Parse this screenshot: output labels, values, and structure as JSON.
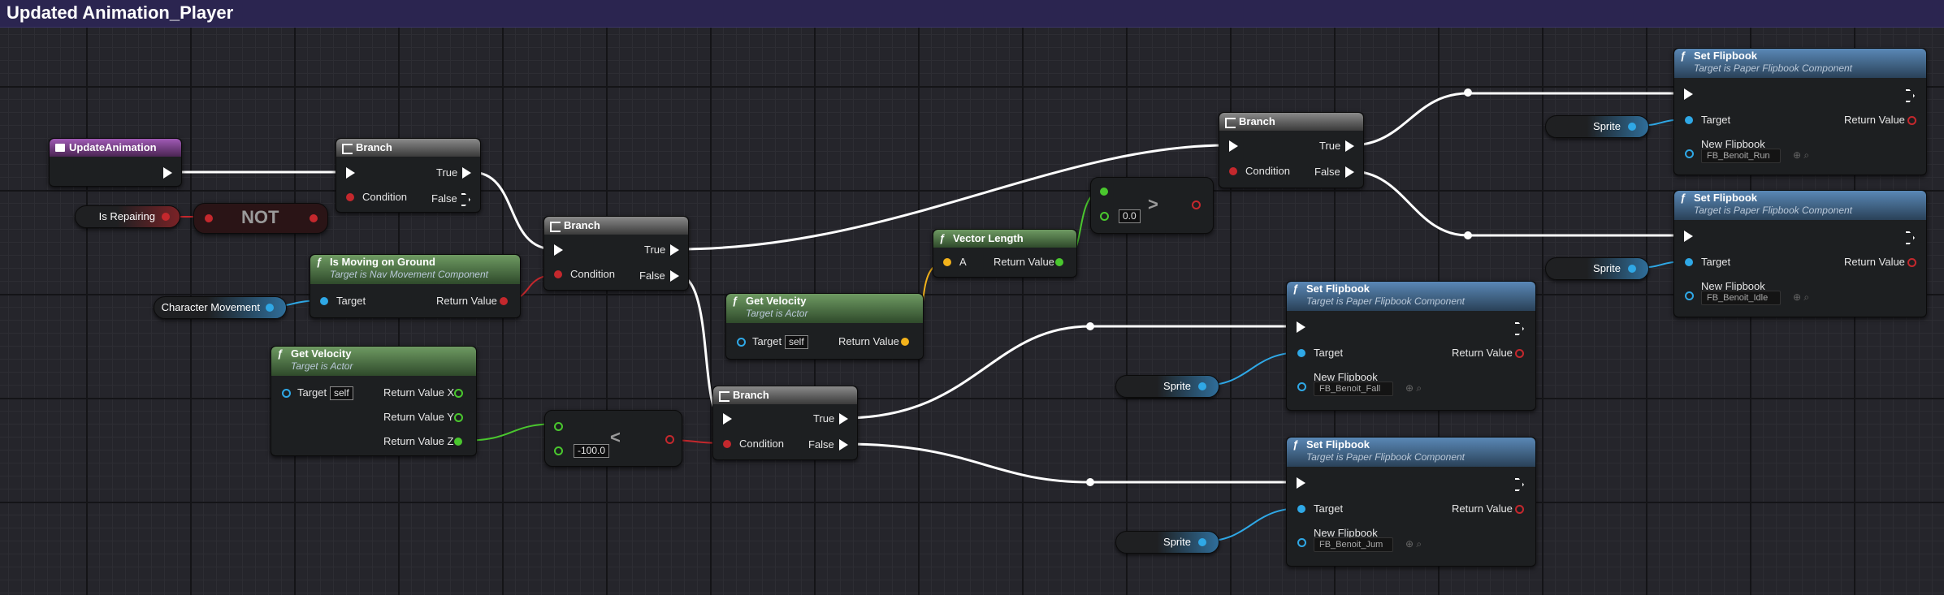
{
  "window": {
    "title": "Updated Animation_Player"
  },
  "colors": {
    "exec": "#ffffff",
    "object": "#2fa8e6",
    "boolean": "#c4282d",
    "float": "#4ac72e",
    "vector": "#f2b21b"
  },
  "nodes": {
    "update_animation": {
      "title": "UpdateAnimation"
    },
    "is_repairing": {
      "label": "Is Repairing"
    },
    "not_node": {
      "label": "NOT"
    },
    "branch1": {
      "title": "Branch",
      "true_label": "True",
      "false_label": "False",
      "condition_label": "Condition"
    },
    "is_moving_on_ground": {
      "title": "Is Moving on Ground",
      "subtitle": "Target is Nav Movement Component",
      "target_label": "Target",
      "return_label": "Return Value"
    },
    "character_movement": {
      "label": "Character Movement"
    },
    "get_velocity_1": {
      "title": "Get Velocity",
      "subtitle": "Target is Actor",
      "target_label": "Target",
      "target_value": "self",
      "x_label": "Return Value X",
      "y_label": "Return Value Y",
      "z_label": "Return Value Z"
    },
    "branch2": {
      "title": "Branch",
      "true_label": "True",
      "false_label": "False",
      "condition_label": "Condition"
    },
    "less_than": {
      "operator": "<",
      "value": "-100.0"
    },
    "get_velocity_2": {
      "title": "Get Velocity",
      "subtitle": "Target is Actor",
      "target_label": "Target",
      "target_value": "self",
      "return_label": "Return Value"
    },
    "branch3": {
      "title": "Branch",
      "true_label": "True",
      "false_label": "False",
      "condition_label": "Condition"
    },
    "vector_length": {
      "title": "Vector Length",
      "a_label": "A",
      "return_label": "Return Value"
    },
    "greater_than": {
      "operator": ">",
      "value": "0.0"
    },
    "branch4": {
      "title": "Branch",
      "true_label": "True",
      "false_label": "False",
      "condition_label": "Condition"
    },
    "set_flipbook_run": {
      "title": "Set Flipbook",
      "subtitle": "Target is Paper Flipbook Component",
      "target_label": "Target",
      "return_label": "Return Value",
      "new_label": "New Flipbook",
      "asset": "FB_Benoit_Run"
    },
    "set_flipbook_idle": {
      "title": "Set Flipbook",
      "subtitle": "Target is Paper Flipbook Component",
      "target_label": "Target",
      "return_label": "Return Value",
      "new_label": "New Flipbook",
      "asset": "FB_Benoit_Idle"
    },
    "set_flipbook_fall": {
      "title": "Set Flipbook",
      "subtitle": "Target is Paper Flipbook Component",
      "target_label": "Target",
      "return_label": "Return Value",
      "new_label": "New Flipbook",
      "asset": "FB_Benoit_Fall"
    },
    "set_flipbook_jump": {
      "title": "Set Flipbook",
      "subtitle": "Target is Paper Flipbook Component",
      "target_label": "Target",
      "return_label": "Return Value",
      "new_label": "New Flipbook",
      "asset": "FB_Benoit_Jum"
    },
    "sprite_getters": [
      "Sprite",
      "Sprite",
      "Sprite",
      "Sprite"
    ]
  }
}
